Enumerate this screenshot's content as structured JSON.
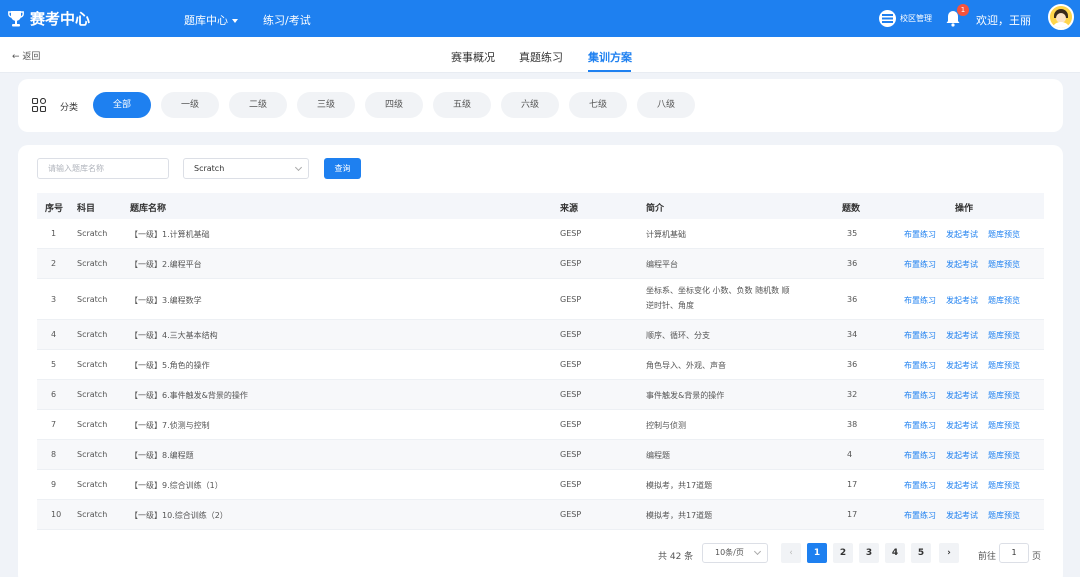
{
  "header": {
    "brand": "赛考中心",
    "nav": [
      {
        "label": "题库中心"
      },
      {
        "label": "练习/考试"
      }
    ],
    "campus": "校区管理",
    "notification_count": "1",
    "welcome": "欢迎，王丽"
  },
  "subnav": {
    "back": "返回",
    "tabs": [
      {
        "label": "赛事概况"
      },
      {
        "label": "真题练习"
      },
      {
        "label": "集训方案"
      }
    ],
    "active_tab": "集训方案"
  },
  "category": {
    "label": "分类",
    "levels": [
      "全部",
      "一级",
      "二级",
      "三级",
      "四级",
      "五级",
      "六级",
      "七级",
      "八级"
    ],
    "active": "全部"
  },
  "filters": {
    "search_placeholder": "请输入题库名称",
    "subject": "Scratch",
    "query_button": "查询"
  },
  "table": {
    "headers": [
      "序号",
      "科目",
      "题库名称",
      "来源",
      "简介",
      "题数",
      "操作"
    ],
    "actions": [
      "布置练习",
      "发起考试",
      "题库预览"
    ],
    "rows": [
      {
        "no": "1",
        "subject": "Scratch",
        "name": "【一级】1.计算机基础",
        "source": "GESP",
        "intro": "计算机基础",
        "count": "35"
      },
      {
        "no": "2",
        "subject": "Scratch",
        "name": "【一级】2.编程平台",
        "source": "GESP",
        "intro": "编程平台",
        "count": "36"
      },
      {
        "no": "3",
        "subject": "Scratch",
        "name": "【一级】3.编程数学",
        "source": "GESP",
        "intro": "坐标系、坐标变化 小数、负数 随机数 顺逆时针、角度",
        "count": "36"
      },
      {
        "no": "4",
        "subject": "Scratch",
        "name": "【一级】4.三大基本结构",
        "source": "GESP",
        "intro": "顺序、循环、分支",
        "count": "34"
      },
      {
        "no": "5",
        "subject": "Scratch",
        "name": "【一级】5.角色的操作",
        "source": "GESP",
        "intro": "角色导入、外观、声音",
        "count": "36"
      },
      {
        "no": "6",
        "subject": "Scratch",
        "name": "【一级】6.事件触发&背景的操作",
        "source": "GESP",
        "intro": "事件触发&背景的操作",
        "count": "32"
      },
      {
        "no": "7",
        "subject": "Scratch",
        "name": "【一级】7.侦测与控制",
        "source": "GESP",
        "intro": "控制与侦测",
        "count": "38"
      },
      {
        "no": "8",
        "subject": "Scratch",
        "name": "【一级】8.编程题",
        "source": "GESP",
        "intro": "编程题",
        "count": "4"
      },
      {
        "no": "9",
        "subject": "Scratch",
        "name": "【一级】9.综合训练（1）",
        "source": "GESP",
        "intro": "模拟考，共17道题",
        "count": "17"
      },
      {
        "no": "10",
        "subject": "Scratch",
        "name": "【一级】10.综合训练（2）",
        "source": "GESP",
        "intro": "模拟考，共17道题",
        "count": "17"
      }
    ]
  },
  "pagination": {
    "total": "共 42 条",
    "page_size": "10条/页",
    "pages": [
      "1",
      "2",
      "3",
      "4",
      "5"
    ],
    "current": "1",
    "prev": "‹",
    "next": "›",
    "goto_label": "前往",
    "goto_value": "1",
    "goto_suffix": "页"
  },
  "colors": {
    "primary": "#1e80f0",
    "badge": "#f5533d"
  }
}
